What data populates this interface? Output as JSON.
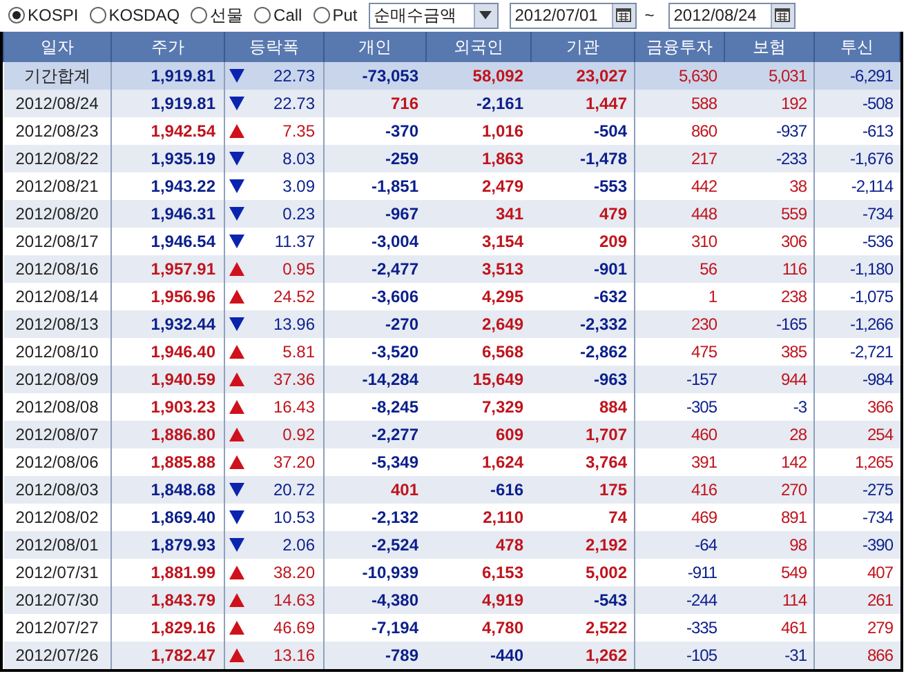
{
  "toolbar": {
    "markets": [
      {
        "label": "KOSPI",
        "selected": true
      },
      {
        "label": "KOSDAQ",
        "selected": false
      },
      {
        "label": "선물",
        "selected": false
      },
      {
        "label": "Call",
        "selected": false
      },
      {
        "label": "Put",
        "selected": false
      }
    ],
    "mode": {
      "value": "순매수금액"
    },
    "start_date": {
      "value": "2012/07/01"
    },
    "separator": "~",
    "end_date": {
      "value": "2012/08/24"
    }
  },
  "table": {
    "columns": [
      "일자",
      "주가",
      "등락폭",
      "개인",
      "외국인",
      "기관",
      "금융투자",
      "보험",
      "투신"
    ],
    "rows": [
      {
        "kind": "total",
        "date": "기간합계",
        "price": "1,919.81",
        "up": false,
        "change": "22.73",
        "flows": [
          "-73,053",
          "58,092",
          "23,027",
          "5,630",
          "5,031",
          "-6,291"
        ]
      },
      {
        "kind": "day",
        "date": "2012/08/24",
        "price": "1,919.81",
        "up": false,
        "change": "22.73",
        "flows": [
          "716",
          "-2,161",
          "1,447",
          "588",
          "192",
          "-508"
        ]
      },
      {
        "kind": "day",
        "date": "2012/08/23",
        "price": "1,942.54",
        "up": true,
        "change": "7.35",
        "flows": [
          "-370",
          "1,016",
          "-504",
          "860",
          "-937",
          "-613"
        ]
      },
      {
        "kind": "day",
        "date": "2012/08/22",
        "price": "1,935.19",
        "up": false,
        "change": "8.03",
        "flows": [
          "-259",
          "1,863",
          "-1,478",
          "217",
          "-233",
          "-1,676"
        ]
      },
      {
        "kind": "day",
        "date": "2012/08/21",
        "price": "1,943.22",
        "up": false,
        "change": "3.09",
        "flows": [
          "-1,851",
          "2,479",
          "-553",
          "442",
          "38",
          "-2,114"
        ]
      },
      {
        "kind": "day",
        "date": "2012/08/20",
        "price": "1,946.31",
        "up": false,
        "change": "0.23",
        "flows": [
          "-967",
          "341",
          "479",
          "448",
          "559",
          "-734"
        ]
      },
      {
        "kind": "day",
        "date": "2012/08/17",
        "price": "1,946.54",
        "up": false,
        "change": "11.37",
        "flows": [
          "-3,004",
          "3,154",
          "209",
          "310",
          "306",
          "-536"
        ]
      },
      {
        "kind": "day",
        "date": "2012/08/16",
        "price": "1,957.91",
        "up": true,
        "change": "0.95",
        "flows": [
          "-2,477",
          "3,513",
          "-901",
          "56",
          "116",
          "-1,180"
        ]
      },
      {
        "kind": "day",
        "date": "2012/08/14",
        "price": "1,956.96",
        "up": true,
        "change": "24.52",
        "flows": [
          "-3,606",
          "4,295",
          "-632",
          "1",
          "238",
          "-1,075"
        ]
      },
      {
        "kind": "day",
        "date": "2012/08/13",
        "price": "1,932.44",
        "up": false,
        "change": "13.96",
        "flows": [
          "-270",
          "2,649",
          "-2,332",
          "230",
          "-165",
          "-1,266"
        ]
      },
      {
        "kind": "day",
        "date": "2012/08/10",
        "price": "1,946.40",
        "up": true,
        "change": "5.81",
        "flows": [
          "-3,520",
          "6,568",
          "-2,862",
          "475",
          "385",
          "-2,721"
        ]
      },
      {
        "kind": "day",
        "date": "2012/08/09",
        "price": "1,940.59",
        "up": true,
        "change": "37.36",
        "flows": [
          "-14,284",
          "15,649",
          "-963",
          "-157",
          "944",
          "-984"
        ]
      },
      {
        "kind": "day",
        "date": "2012/08/08",
        "price": "1,903.23",
        "up": true,
        "change": "16.43",
        "flows": [
          "-8,245",
          "7,329",
          "884",
          "-305",
          "-3",
          "366"
        ]
      },
      {
        "kind": "day",
        "date": "2012/08/07",
        "price": "1,886.80",
        "up": true,
        "change": "0.92",
        "flows": [
          "-2,277",
          "609",
          "1,707",
          "460",
          "28",
          "254"
        ]
      },
      {
        "kind": "day",
        "date": "2012/08/06",
        "price": "1,885.88",
        "up": true,
        "change": "37.20",
        "flows": [
          "-5,349",
          "1,624",
          "3,764",
          "391",
          "142",
          "1,265"
        ]
      },
      {
        "kind": "day",
        "date": "2012/08/03",
        "price": "1,848.68",
        "up": false,
        "change": "20.72",
        "flows": [
          "401",
          "-616",
          "175",
          "416",
          "270",
          "-275"
        ]
      },
      {
        "kind": "day",
        "date": "2012/08/02",
        "price": "1,869.40",
        "up": false,
        "change": "10.53",
        "flows": [
          "-2,132",
          "2,110",
          "74",
          "469",
          "891",
          "-734"
        ]
      },
      {
        "kind": "day",
        "date": "2012/08/01",
        "price": "1,879.93",
        "up": false,
        "change": "2.06",
        "flows": [
          "-2,524",
          "478",
          "2,192",
          "-64",
          "98",
          "-390"
        ]
      },
      {
        "kind": "day",
        "date": "2012/07/31",
        "price": "1,881.99",
        "up": true,
        "change": "38.20",
        "flows": [
          "-10,939",
          "6,153",
          "5,002",
          "-911",
          "549",
          "407"
        ]
      },
      {
        "kind": "day",
        "date": "2012/07/30",
        "price": "1,843.79",
        "up": true,
        "change": "14.63",
        "flows": [
          "-4,380",
          "4,919",
          "-543",
          "-244",
          "114",
          "261"
        ]
      },
      {
        "kind": "day",
        "date": "2012/07/27",
        "price": "1,829.16",
        "up": true,
        "change": "46.69",
        "flows": [
          "-7,194",
          "4,780",
          "2,522",
          "-335",
          "461",
          "279"
        ]
      },
      {
        "kind": "day",
        "date": "2012/07/26",
        "price": "1,782.47",
        "up": true,
        "change": "13.16",
        "flows": [
          "-789",
          "-440",
          "1,262",
          "-105",
          "-31",
          "866"
        ]
      }
    ]
  }
}
